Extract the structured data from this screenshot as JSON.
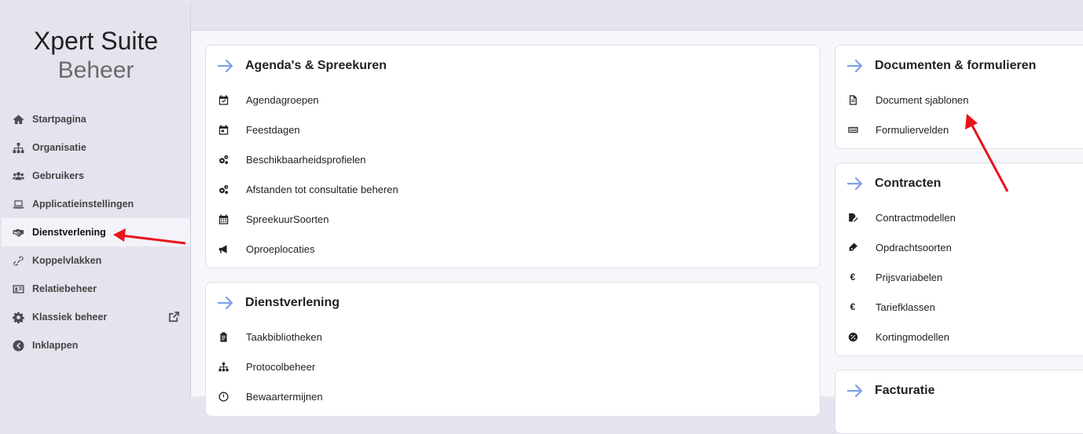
{
  "brand": {
    "line1": "Xpert Suite",
    "line2": "Beheer"
  },
  "sidebar": {
    "items": [
      {
        "label": "Startpagina",
        "icon": "home-icon"
      },
      {
        "label": "Organisatie",
        "icon": "sitemap-icon"
      },
      {
        "label": "Gebruikers",
        "icon": "users-icon"
      },
      {
        "label": "Applicatieinstellingen",
        "icon": "laptop-icon"
      },
      {
        "label": "Dienstverlening",
        "icon": "handshake-icon",
        "active": true
      },
      {
        "label": "Koppelvlakken",
        "icon": "link-icon"
      },
      {
        "label": "Relatiebeheer",
        "icon": "id-card-icon"
      },
      {
        "label": "Klassiek beheer",
        "icon": "gear-icon",
        "external": true
      },
      {
        "label": "Inklappen",
        "icon": "chevron-left-circle-icon"
      }
    ]
  },
  "cards": {
    "agenda": {
      "title": "Agenda's & Spreekuren",
      "items": [
        {
          "label": "Agendagroepen",
          "icon": "calendar-check-icon"
        },
        {
          "label": "Feestdagen",
          "icon": "calendar-day-icon"
        },
        {
          "label": "Beschikbaarheidsprofielen",
          "icon": "gears-icon"
        },
        {
          "label": "Afstanden tot consultatie beheren",
          "icon": "gears-icon"
        },
        {
          "label": "SpreekuurSoorten",
          "icon": "calendar-grid-icon"
        },
        {
          "label": "Oproeplocaties",
          "icon": "megaphone-icon"
        }
      ]
    },
    "dienstverlening": {
      "title": "Dienstverlening",
      "items": [
        {
          "label": "Taakbibliotheken",
          "icon": "clipboard-icon"
        },
        {
          "label": "Protocolbeheer",
          "icon": "sitemap-icon"
        },
        {
          "label": "Bewaartermijnen",
          "icon": "clock-icon"
        }
      ]
    },
    "documenten": {
      "title": "Documenten & formulieren",
      "items": [
        {
          "label": "Document sjablonen",
          "icon": "file-icon"
        },
        {
          "label": "Formuliervelden",
          "icon": "keyboard-icon"
        }
      ]
    },
    "contracten": {
      "title": "Contracten",
      "items": [
        {
          "label": "Contractmodellen",
          "icon": "file-signature-icon"
        },
        {
          "label": "Opdrachtsoorten",
          "icon": "pen-nib-icon"
        },
        {
          "label": "Prijsvariabelen",
          "icon": "euro-icon",
          "glyph": "€"
        },
        {
          "label": "Tariefklassen",
          "icon": "euro-icon",
          "glyph": "€"
        },
        {
          "label": "Kortingmodellen",
          "icon": "percent-badge-icon"
        }
      ]
    },
    "facturatie": {
      "title": "Facturatie"
    }
  },
  "colors": {
    "accent_arrow": "#7ea0e6",
    "annotation": "#e8141c"
  }
}
